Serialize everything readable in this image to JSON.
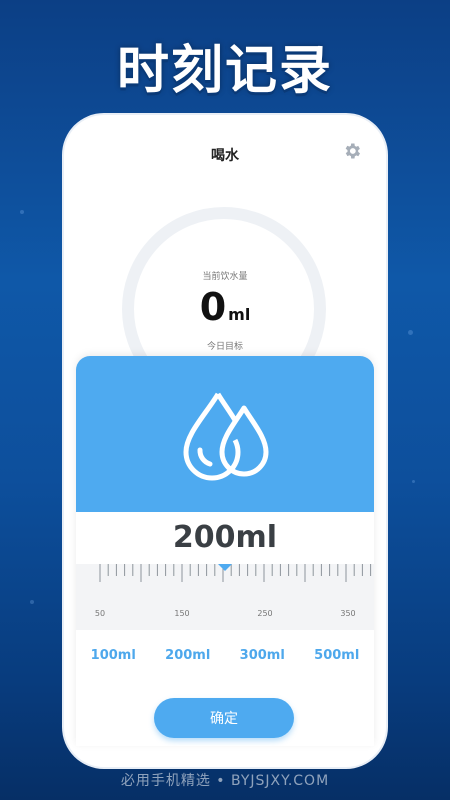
{
  "banner": {
    "title": "时刻记录"
  },
  "app": {
    "title": "喝水",
    "settings_icon": "gear-icon",
    "current_label": "当前饮水量",
    "current_value": "0",
    "current_unit": "ml",
    "goal_label": "今日目标"
  },
  "picker": {
    "icon": "water-drops-icon",
    "amount": "200ml",
    "ruler_labels": [
      "50",
      "150",
      "250",
      "350"
    ],
    "quick_options": [
      "100ml",
      "200ml",
      "300ml",
      "500ml"
    ],
    "confirm_label": "确定"
  },
  "watermark": "必用手机精选 • BYJSJXY.COM",
  "colors": {
    "accent": "#4eaaf0",
    "background": "#0f58a8"
  }
}
